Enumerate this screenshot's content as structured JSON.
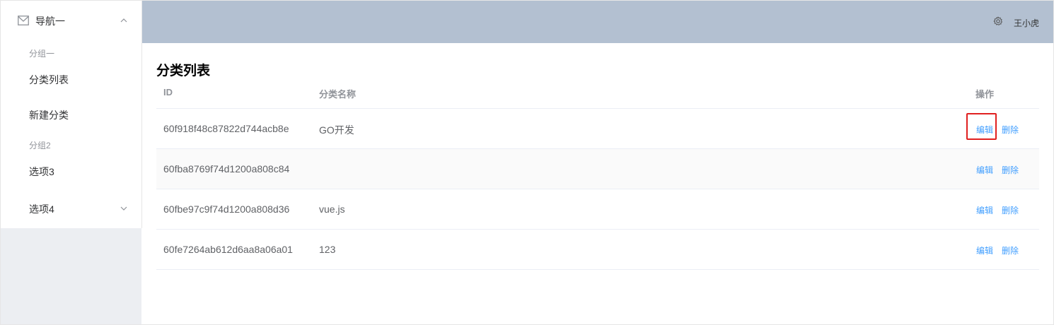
{
  "sidebar": {
    "nav1": {
      "label": "导航一",
      "icon": "envelope-icon",
      "state": "expanded"
    },
    "groups": [
      {
        "title": "分组一",
        "items": [
          "分类列表",
          "新建分类"
        ]
      },
      {
        "title": "分组2",
        "items": [
          "选项3"
        ]
      }
    ],
    "option4": {
      "label": "选项4",
      "state": "collapsed"
    }
  },
  "header": {
    "username": "王小虎",
    "icon": "gear-icon",
    "bg_color": "#b3c0d1"
  },
  "main": {
    "title": "分类列表",
    "table": {
      "columns": [
        "ID",
        "分类名称",
        "操作"
      ],
      "rows": [
        {
          "id": "60f918f48c87822d744acb8e",
          "name": "GO开发",
          "edit": "编辑",
          "delete": "删除"
        },
        {
          "id": "60fba8769f74d1200a808c84",
          "name": "",
          "edit": "编辑",
          "delete": "删除"
        },
        {
          "id": "60fbe97c9f74d1200a808d36",
          "name": "vue.js",
          "edit": "编辑",
          "delete": "删除"
        },
        {
          "id": "60fe7264ab612d6aa8a06a01",
          "name": "123",
          "edit": "编辑",
          "delete": "删除"
        }
      ]
    },
    "link_color": "#409eff",
    "highlight_color": "#e02020"
  }
}
